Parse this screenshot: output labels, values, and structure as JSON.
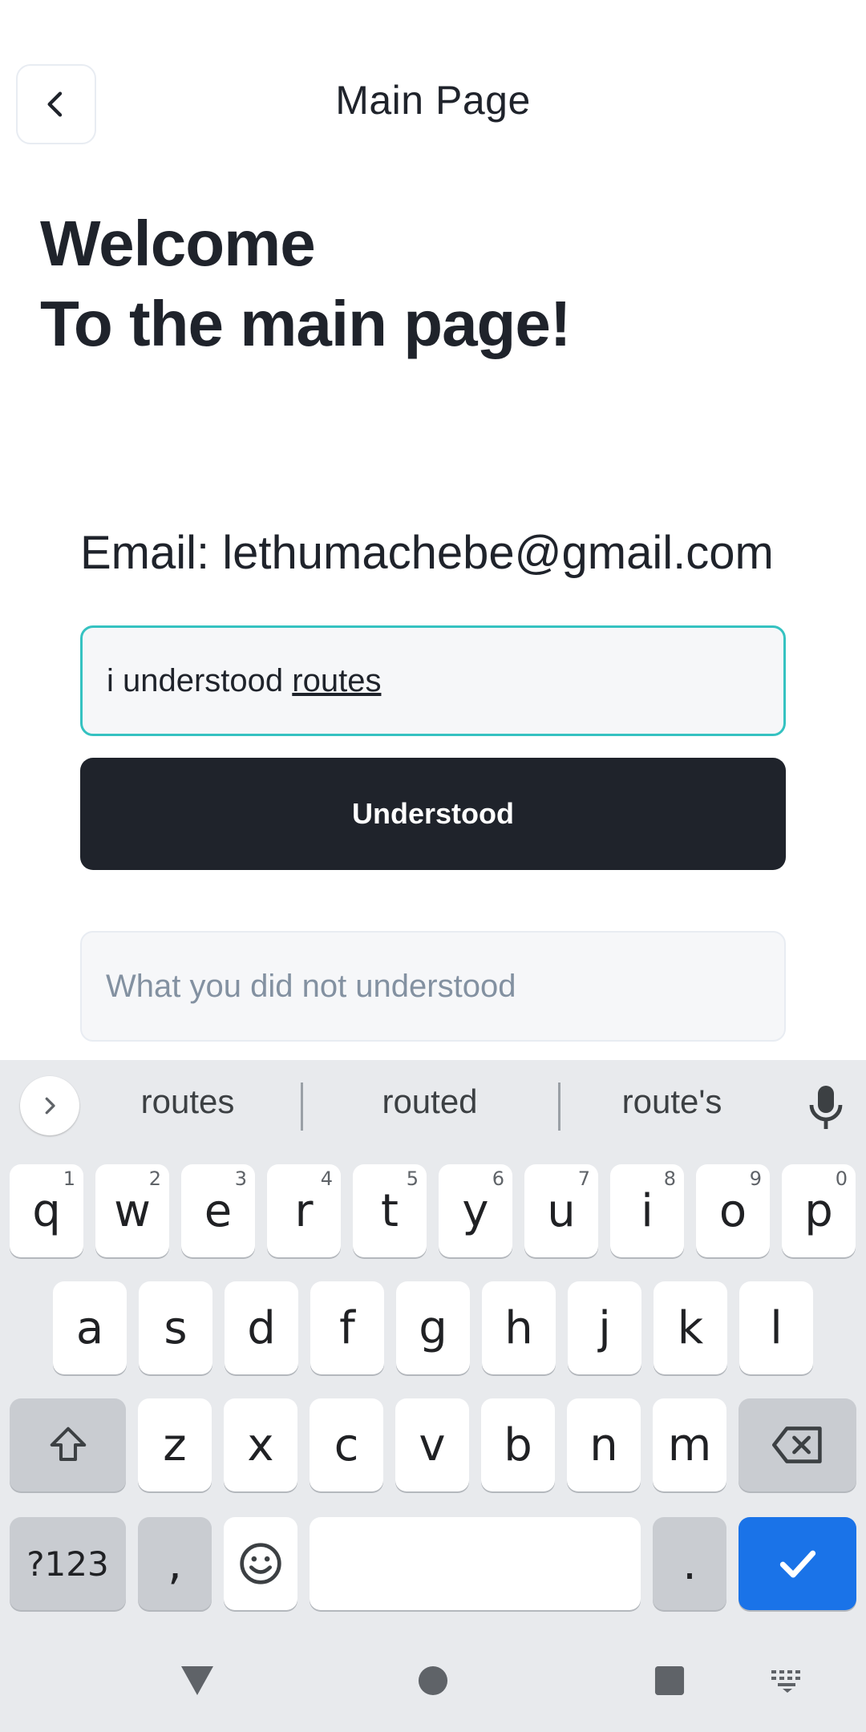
{
  "header": {
    "title": "Main Page"
  },
  "welcome": {
    "line1": "Welcome",
    "line2": "To the main page!"
  },
  "email": {
    "label": "Email: lethumachebe@gmail.com"
  },
  "form": {
    "understood_input": {
      "value_prefix": "i understood ",
      "value_underlined": "routes"
    },
    "understood_button": "Understood",
    "not_understood_input": {
      "placeholder": "What you did not understood"
    }
  },
  "keyboard": {
    "suggestions": [
      "routes",
      "routed",
      "route's"
    ],
    "row1": [
      {
        "k": "q",
        "h": "1"
      },
      {
        "k": "w",
        "h": "2"
      },
      {
        "k": "e",
        "h": "3"
      },
      {
        "k": "r",
        "h": "4"
      },
      {
        "k": "t",
        "h": "5"
      },
      {
        "k": "y",
        "h": "6"
      },
      {
        "k": "u",
        "h": "7"
      },
      {
        "k": "i",
        "h": "8"
      },
      {
        "k": "o",
        "h": "9"
      },
      {
        "k": "p",
        "h": "0"
      }
    ],
    "row2": [
      "a",
      "s",
      "d",
      "f",
      "g",
      "h",
      "j",
      "k",
      "l"
    ],
    "row3": [
      "z",
      "x",
      "c",
      "v",
      "b",
      "n",
      "m"
    ],
    "symbols_key": "?123",
    "comma_key": ",",
    "period_key": ".",
    "action_color": "#1a73e8"
  },
  "colors": {
    "dark": "#1f232b",
    "accent": "#35c2c1",
    "placeholder": "#8391a1"
  },
  "icons": {
    "back": "chevron-left-icon",
    "expand": "chevron-right-icon",
    "mic": "mic-icon",
    "shift": "shift-icon",
    "backspace": "backspace-icon",
    "emoji": "emoji-icon",
    "enter": "check-icon",
    "nav_back": "nav-back-icon",
    "nav_home": "nav-home-icon",
    "nav_recents": "nav-recents-icon",
    "nav_keyboard": "keyboard-switch-icon"
  }
}
